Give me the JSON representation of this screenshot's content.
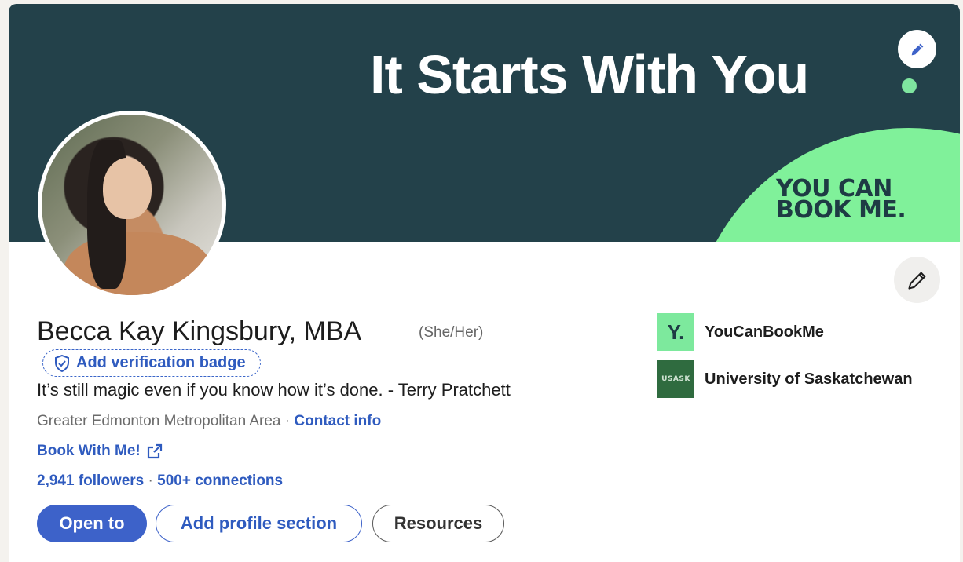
{
  "banner": {
    "headline": "It Starts With You",
    "logo_line1": "YOU CAN",
    "logo_line2": "BOOK ME.",
    "bg_color": "#23414a",
    "accent_color": "#80f19a"
  },
  "profile": {
    "name": "Becca Kay Kingsbury, MBA",
    "pronouns": "(She/Her)",
    "verify_label": "Add verification badge",
    "headline": "It’s still magic even if you know how it’s done. - Terry Pratchett",
    "location": "Greater Edmonton Metropolitan Area",
    "location_sep": " · ",
    "contact_info": "Contact info",
    "book_link": "Book With Me!",
    "followers": "2,941 followers",
    "stats_sep": " · ",
    "connections": "500+ connections"
  },
  "actions": {
    "open_to": "Open to",
    "add_section": "Add profile section",
    "resources": "Resources"
  },
  "orgs": [
    {
      "name": "YouCanBookMe",
      "logo_text": "Y."
    },
    {
      "name": "University of Saskatchewan",
      "logo_text": "USASK"
    }
  ],
  "colors": {
    "link_blue": "#2f5bbf",
    "primary_button": "#3d62c9"
  },
  "icons": {
    "banner_edit": "pencil-icon",
    "profile_edit": "pencil-icon",
    "verify": "shield-check-icon",
    "external_link": "external-link-icon"
  }
}
